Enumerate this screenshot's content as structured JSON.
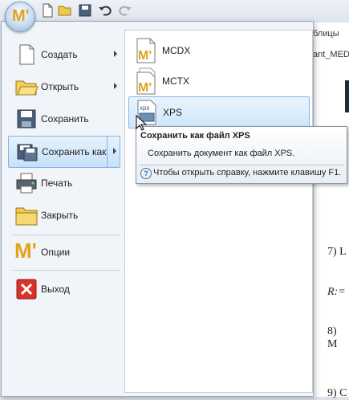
{
  "toolbar": {
    "icons": [
      "app-menu-icon",
      "new-file-icon",
      "open-folder-icon",
      "save-icon",
      "undo-icon",
      "redo-icon"
    ]
  },
  "background": {
    "tab_fragment": "блицы",
    "file_fragment": "ant_MED",
    "doc_lines": [
      "7) L",
      "R:=",
      "8) M",
      "9) C"
    ]
  },
  "menu": {
    "left_items": [
      {
        "label": "Создать",
        "icon": "new-file-icon",
        "has_submenu": true
      },
      {
        "label": "Открыть",
        "icon": "open-folder-icon",
        "has_submenu": true
      },
      {
        "label": "Сохранить",
        "icon": "save-icon",
        "has_submenu": false
      },
      {
        "label": "Сохранить как",
        "icon": "save-as-icon",
        "has_submenu": true,
        "selected": true
      },
      {
        "label": "Печать",
        "icon": "printer-icon",
        "has_submenu": false
      },
      {
        "label": "Закрыть",
        "icon": "close-folder-icon",
        "has_submenu": false
      },
      {
        "label": "Опции",
        "icon": "options-m-icon",
        "has_submenu": false
      },
      {
        "label": "Выход",
        "icon": "exit-icon",
        "has_submenu": false
      }
    ],
    "right_items": [
      {
        "label": "MCDX",
        "icon": "mcdx-file-icon"
      },
      {
        "label": "MCTX",
        "icon": "mctx-file-icon"
      },
      {
        "label": "XPS",
        "icon": "xps-file-icon",
        "selected": true
      }
    ]
  },
  "tooltip": {
    "title": "Сохранить как файл XPS",
    "description": "Сохранить документ как файл XPS.",
    "help": "Чтобы открыть справку, нажмите клавишу F1."
  },
  "colors": {
    "accent": "#7eb4ea",
    "brand_m": "#e3a21a",
    "exit_red": "#d8322a"
  }
}
